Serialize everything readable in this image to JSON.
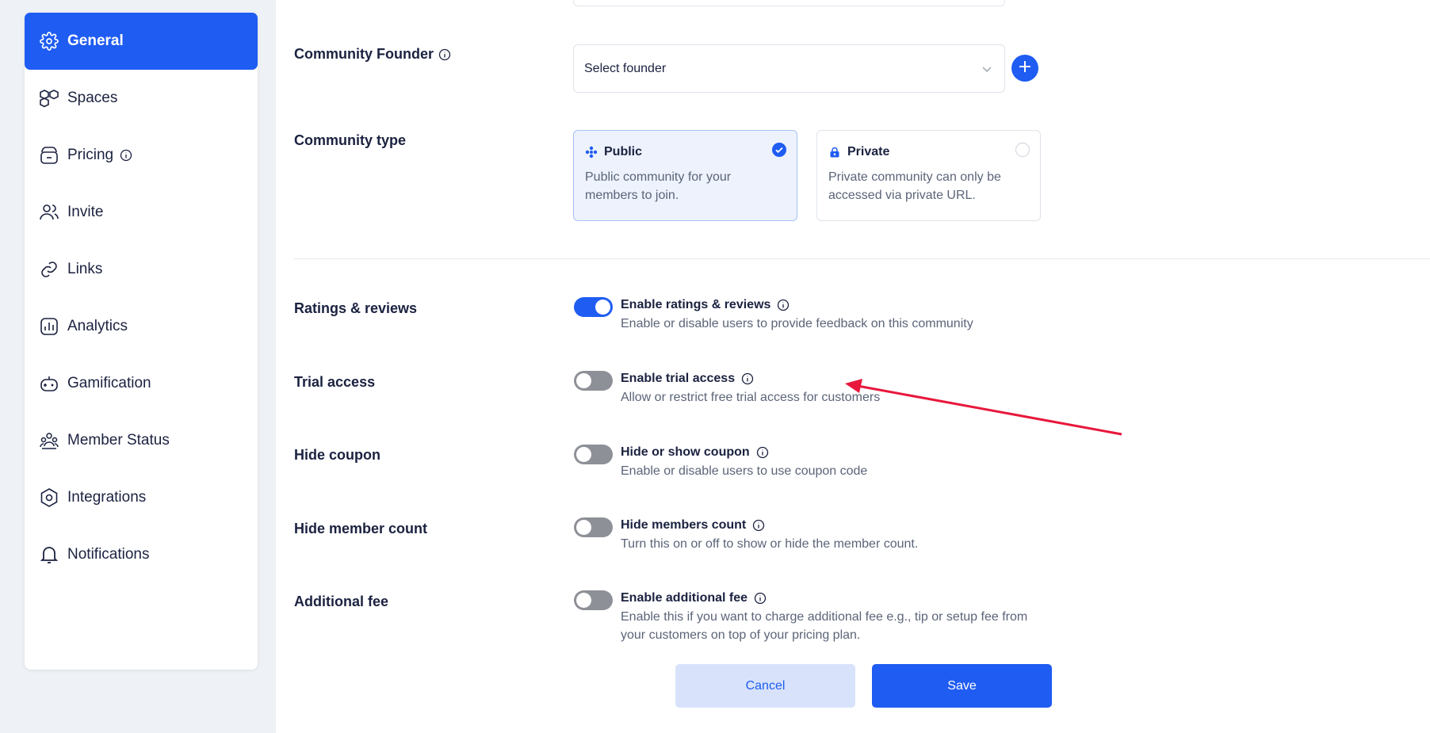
{
  "sidebar": {
    "items": [
      {
        "label": "General",
        "icon": "gear-icon",
        "active": true
      },
      {
        "label": "Spaces",
        "icon": "cubes-icon"
      },
      {
        "label": "Pricing",
        "icon": "wallet-icon",
        "info": true
      },
      {
        "label": "Invite",
        "icon": "users-icon"
      },
      {
        "label": "Links",
        "icon": "link-icon"
      },
      {
        "label": "Analytics",
        "icon": "analytics-icon"
      },
      {
        "label": "Gamification",
        "icon": "gamepad-icon"
      },
      {
        "label": "Member Status",
        "icon": "members-icon"
      },
      {
        "label": "Integrations",
        "icon": "hexagon-icon"
      },
      {
        "label": "Notifications",
        "icon": "bell-icon"
      }
    ]
  },
  "founder": {
    "label": "Community Founder",
    "placeholder": "Select founder"
  },
  "community_type": {
    "label": "Community type",
    "public": {
      "title": "Public",
      "desc": "Public community for your members to join.",
      "selected": true
    },
    "private": {
      "title": "Private",
      "desc": "Private community can only be accessed via private URL.",
      "selected": false
    }
  },
  "settings": [
    {
      "label": "Ratings & reviews",
      "title": "Enable ratings & reviews",
      "desc": "Enable or disable users to provide feedback on this community",
      "on": true
    },
    {
      "label": "Trial access",
      "title": "Enable trial access",
      "desc": "Allow or restrict free trial access for customers",
      "on": false
    },
    {
      "label": "Hide coupon",
      "title": "Hide or show coupon",
      "desc": "Enable or disable users to use coupon code",
      "on": false
    },
    {
      "label": "Hide member count",
      "title": "Hide members count",
      "desc": "Turn this on or off to show or hide the member count.",
      "on": false
    },
    {
      "label": "Additional fee",
      "title": "Enable additional fee",
      "desc": "Enable this if you want to charge additional fee e.g., tip or setup fee from your customers on top of your pricing plan.",
      "on": false
    }
  ],
  "actions": {
    "cancel": "Cancel",
    "save": "Save"
  },
  "colors": {
    "accent": "#1f5cf2",
    "annotation_arrow": "#e8173b"
  }
}
